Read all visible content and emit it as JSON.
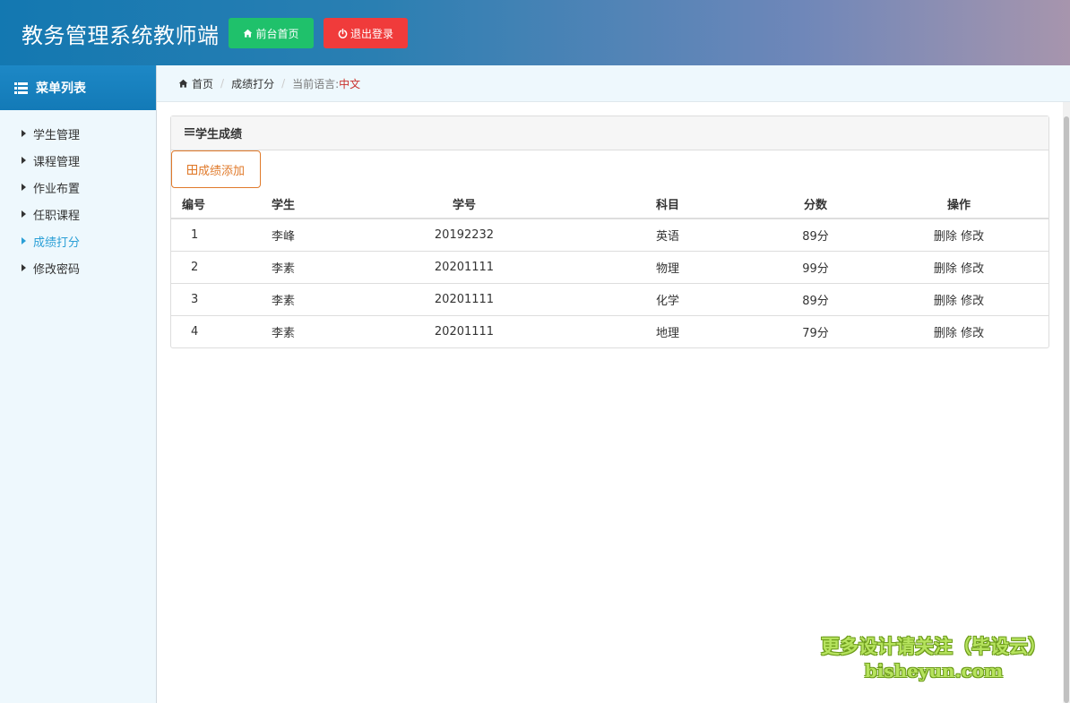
{
  "header": {
    "title": "教务管理系统教师端",
    "home_label": "前台首页",
    "logout_label": "退出登录",
    "colors": {
      "home": "#1fc16b",
      "logout": "#f03b3b"
    }
  },
  "sidebar": {
    "title": "菜单列表",
    "items": [
      {
        "label": "学生管理",
        "active": false
      },
      {
        "label": "课程管理",
        "active": false
      },
      {
        "label": "作业布置",
        "active": false
      },
      {
        "label": "任职课程",
        "active": false
      },
      {
        "label": "成绩打分",
        "active": true
      },
      {
        "label": "修改密码",
        "active": false
      }
    ]
  },
  "breadcrumb": {
    "home": "首页",
    "current": "成绩打分",
    "lang_label": "当前语言:",
    "lang_value": "中文"
  },
  "panel": {
    "title": "学生成绩",
    "add_button": "成绩添加",
    "columns": [
      "编号",
      "学生",
      "学号",
      "科目",
      "分数",
      "操作"
    ],
    "rows": [
      {
        "id": "1",
        "student": "李峰",
        "student_no": "20192232",
        "subject": "英语",
        "score": "89分",
        "delete": "删除",
        "edit": "修改"
      },
      {
        "id": "2",
        "student": "李素",
        "student_no": "20201111",
        "subject": "物理",
        "score": "99分",
        "delete": "删除",
        "edit": "修改"
      },
      {
        "id": "3",
        "student": "李素",
        "student_no": "20201111",
        "subject": "化学",
        "score": "89分",
        "delete": "删除",
        "edit": "修改"
      },
      {
        "id": "4",
        "student": "李素",
        "student_no": "20201111",
        "subject": "地理",
        "score": "79分",
        "delete": "删除",
        "edit": "修改"
      }
    ]
  },
  "watermark": {
    "line1": "更多设计请关注（毕设云）",
    "line2": "bisheyun.com"
  }
}
